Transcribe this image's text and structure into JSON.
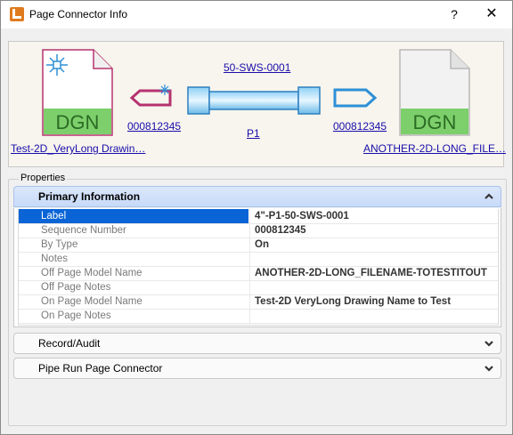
{
  "window": {
    "title": "Page Connector Info",
    "help_symbol": "?",
    "close_symbol": "✕"
  },
  "connector": {
    "left_doc_type": "DGN",
    "right_doc_type": "DGN",
    "left_doc_name": "Test-2D_VeryLong Drawin…",
    "right_doc_name": "ANOTHER-2D-LONG_FILE…",
    "left_sequence": "000812345",
    "right_sequence": "000812345",
    "pipe_name": "50-SWS-0001",
    "pipe_run": "P1"
  },
  "properties": {
    "group_label": "Properties",
    "sections": [
      {
        "title": "Primary Information",
        "expanded": true
      },
      {
        "title": "Record/Audit",
        "expanded": false
      },
      {
        "title": "Pipe Run Page Connector",
        "expanded": false
      }
    ],
    "rows": [
      {
        "label": "Label",
        "value": "4\"-P1-50-SWS-0001"
      },
      {
        "label": "Sequence Number",
        "value": "000812345"
      },
      {
        "label": "By Type",
        "value": "On"
      },
      {
        "label": "Notes",
        "value": ""
      },
      {
        "label": "Off Page Model Name",
        "value": "ANOTHER-2D-LONG_FILENAME-TOTESTITOUT"
      },
      {
        "label": "Off Page Notes",
        "value": ""
      },
      {
        "label": "On Page Model Name",
        "value": "Test-2D VeryLong Drawing Name to Test"
      },
      {
        "label": "On Page Notes",
        "value": ""
      }
    ]
  },
  "colors": {
    "doc_fill_green": "#7dcf6b",
    "doc_text_green": "#2b6b24",
    "connector_magenta": "#b5336f",
    "connector_blue": "#2e8fd6",
    "selection_blue": "#0a64d6"
  }
}
